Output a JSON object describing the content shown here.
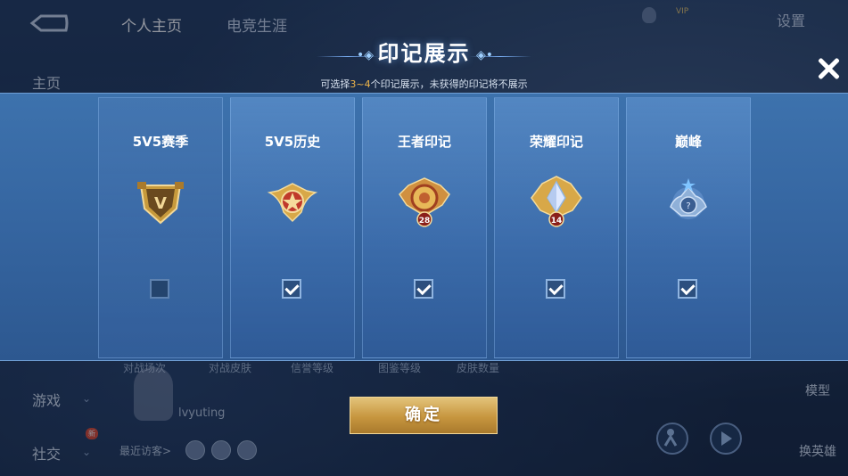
{
  "background": {
    "tabs": [
      "个人主页",
      "电竞生涯"
    ],
    "settings_label": "设置",
    "vip_label": "VIP",
    "nav": {
      "home": "主页",
      "game": "游戏",
      "social": "社交",
      "new_badge": "新"
    },
    "stats": [
      "对战场次",
      "对战皮肤",
      "信誉等级",
      "图鉴等级",
      "皮肤数量"
    ],
    "user_name": "lvyuting",
    "recent_visitors": "最近访客>",
    "right_controls": {
      "model": "模型",
      "switch_hero": "换英雄"
    }
  },
  "dialog": {
    "title": "印记展示",
    "subtitle_prefix": "可选择",
    "subtitle_range": "3~4",
    "subtitle_suffix": "个印记展示，未获得的印记将不展示",
    "confirm_label": "确定",
    "cards": [
      {
        "label": "5V5赛季",
        "checked": false,
        "emblem": "gold-shield-V-icon"
      },
      {
        "label": "5V5历史",
        "checked": true,
        "emblem": "gold-star-wing-icon"
      },
      {
        "label": "王者印记",
        "checked": true,
        "emblem": "king-seal-28-icon",
        "badge": "28"
      },
      {
        "label": "荣耀印记",
        "checked": true,
        "emblem": "glory-crystal-14-icon",
        "badge": "14"
      },
      {
        "label": "巅峰",
        "checked": true,
        "emblem": "peak-unknown-icon",
        "badge": "?"
      }
    ]
  },
  "colors": {
    "accent_gold": "#f0b64a",
    "panel_blue": "#3565a0"
  }
}
